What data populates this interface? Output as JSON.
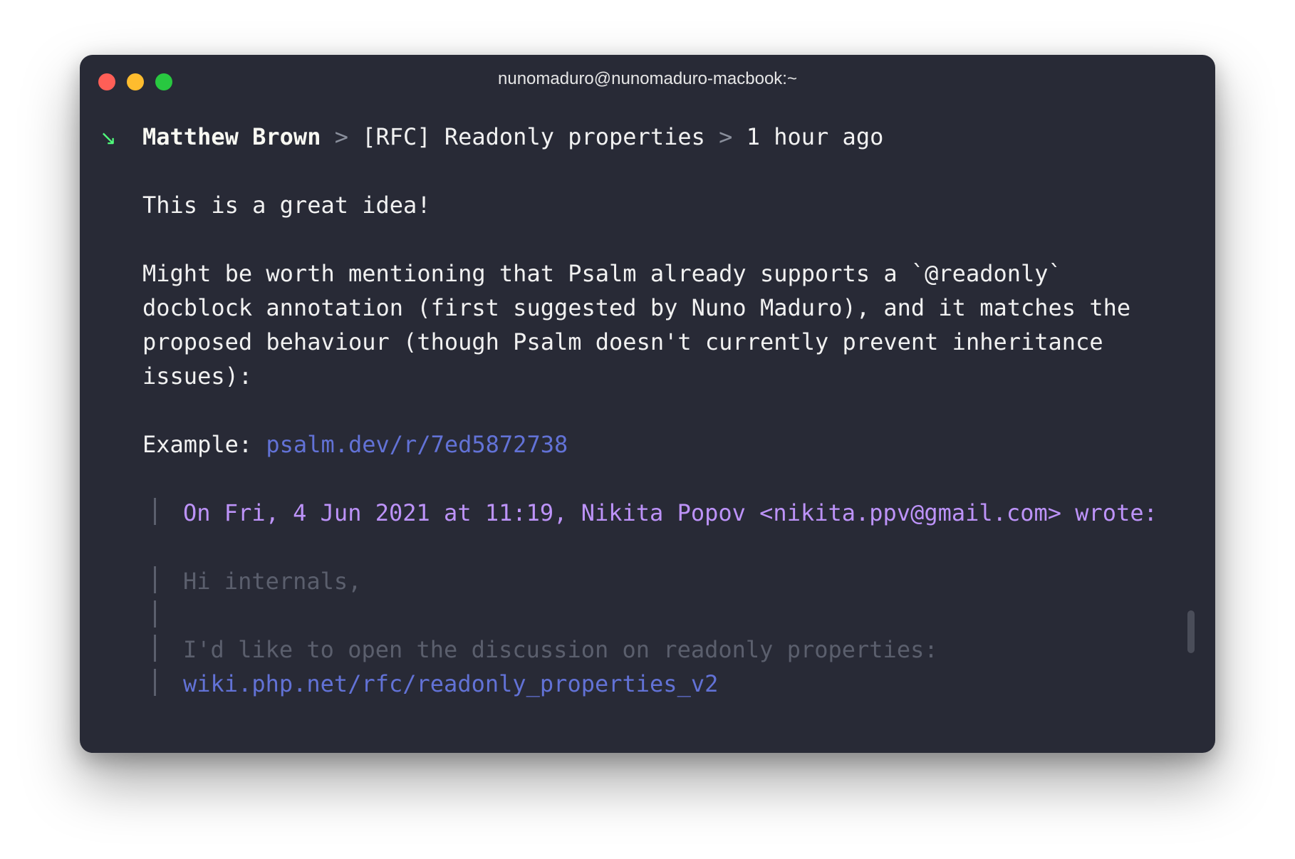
{
  "window": {
    "title": "nunomaduro@nunomaduro-macbook:~"
  },
  "header": {
    "icon": "arrow-down-right-icon",
    "author": "Matthew Brown",
    "separator": ">",
    "thread": "[RFC] Readonly properties",
    "time": "1 hour ago"
  },
  "body": {
    "lines": [
      "This is a great idea!",
      "Might be worth mentioning that Psalm already supports a `@readonly`",
      "docblock annotation (first suggested by Nuno Maduro), and it matches the",
      "proposed behaviour (though Psalm doesn't currently prevent inheritance",
      "issues):"
    ],
    "example_label": "Example:",
    "example_link": "psalm.dev/r/7ed5872738"
  },
  "quote": {
    "header": "On Fri, 4 Jun 2021 at 11:19, Nikita Popov <nikita.ppv@gmail.com> wrote:",
    "greeting": "Hi internals,",
    "text": "I'd like to open the discussion on readonly properties:",
    "link": "wiki.php.net/rfc/readonly_properties_v2"
  },
  "colors": {
    "background": "#282a36",
    "link": "#6272d6",
    "quote_header": "#bd93f9",
    "muted": "#5b5f6d",
    "icon": "#50fa7b"
  }
}
